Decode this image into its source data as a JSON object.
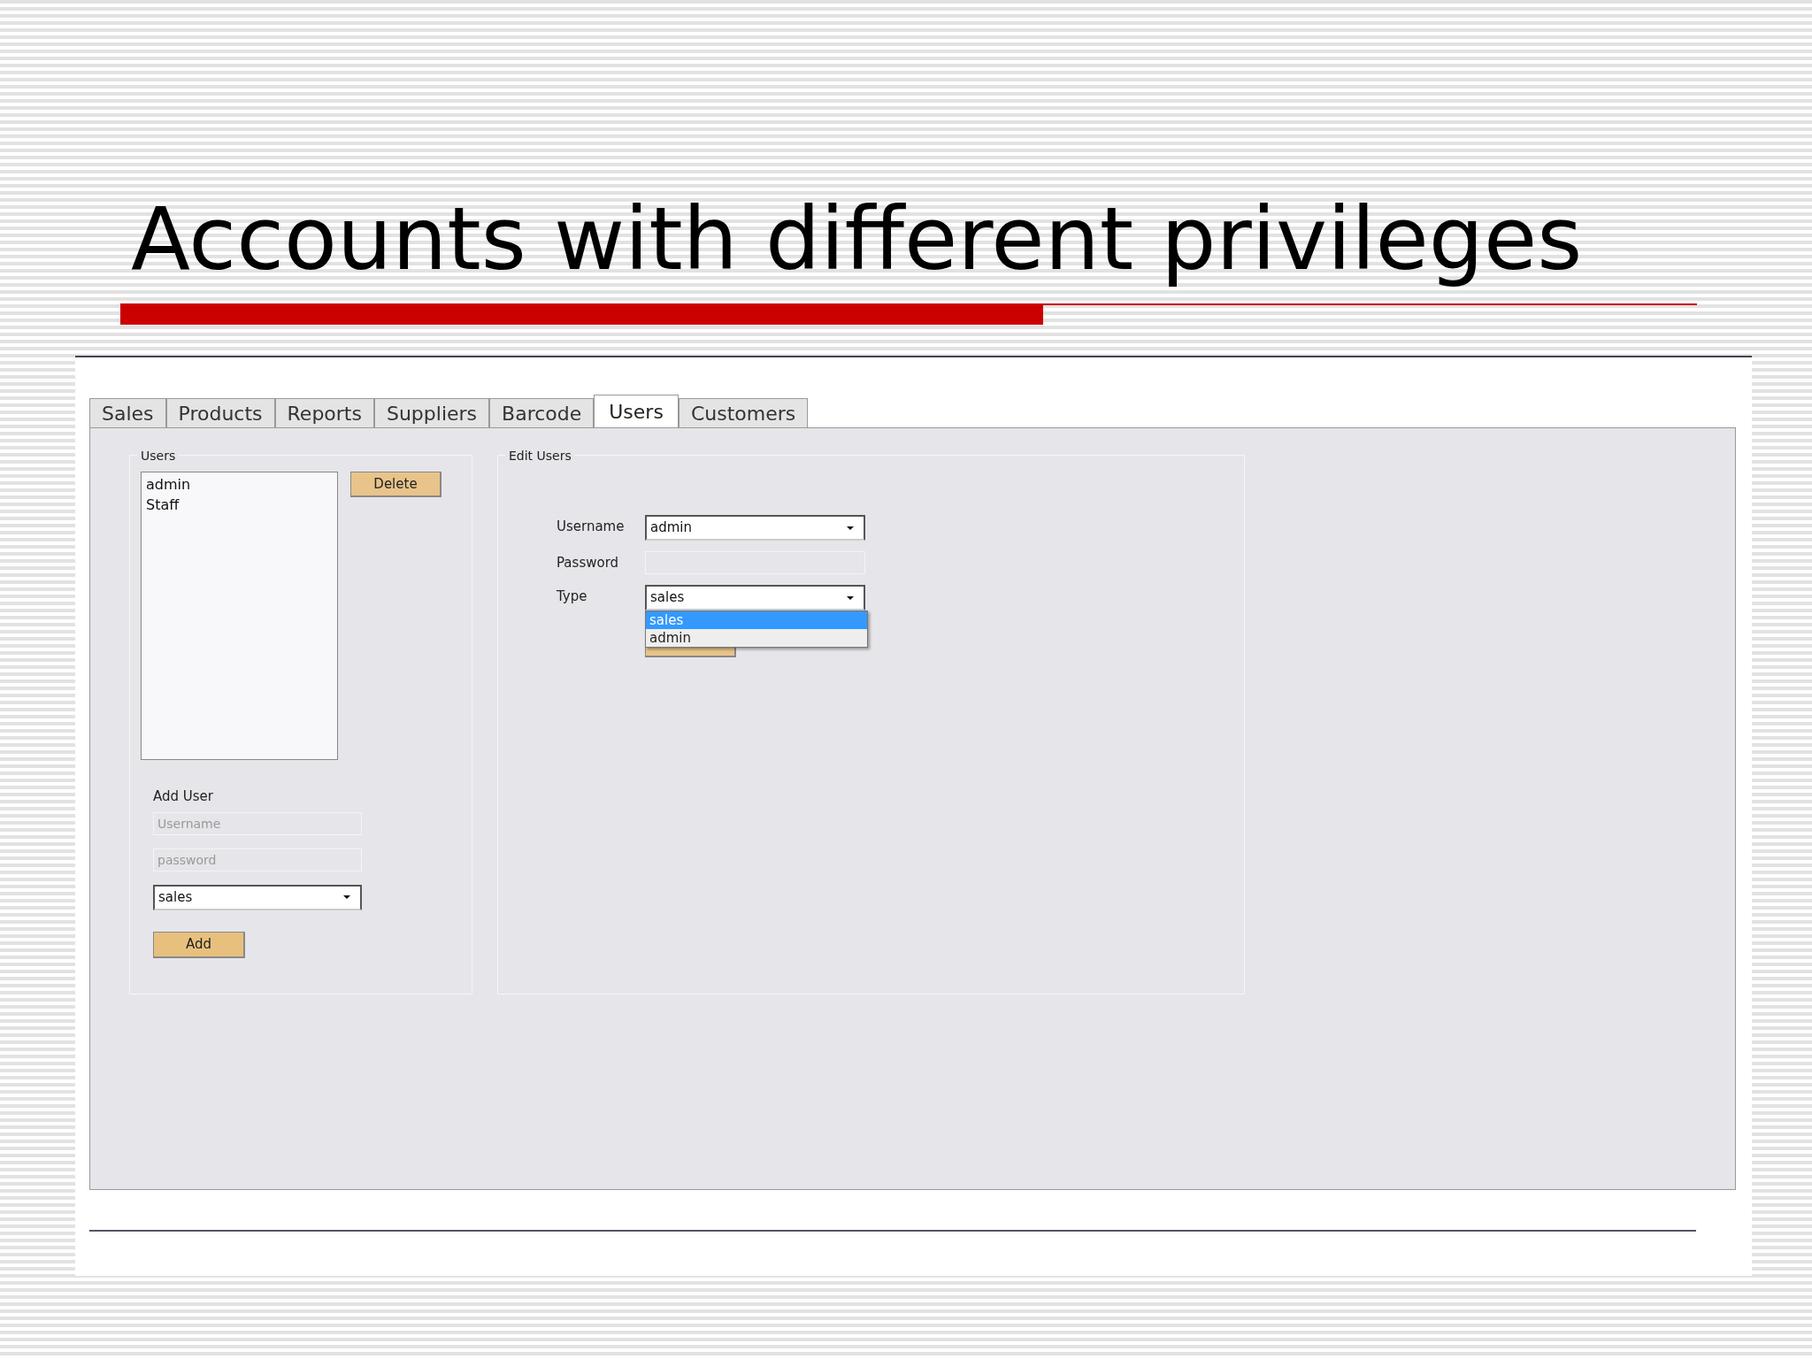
{
  "slide": {
    "title": "Accounts with different privileges"
  },
  "tabs": [
    {
      "label": "Sales",
      "selected": false
    },
    {
      "label": "Products",
      "selected": false
    },
    {
      "label": "Reports",
      "selected": false
    },
    {
      "label": "Suppliers",
      "selected": false
    },
    {
      "label": "Barcode",
      "selected": false
    },
    {
      "label": "Users",
      "selected": true
    },
    {
      "label": "Customers",
      "selected": false
    }
  ],
  "users_group": {
    "title": "Users",
    "list": [
      {
        "label": "admin"
      },
      {
        "label": "Staff"
      }
    ],
    "delete_button": "Delete",
    "add_user": {
      "title": "Add User",
      "username": {
        "placeholder": "Username"
      },
      "password": {
        "placeholder": "password"
      },
      "type": {
        "value": "sales"
      },
      "add_button": "Add"
    }
  },
  "edit_group": {
    "title": "Edit Users",
    "fields": [
      {
        "kind": "select",
        "label": "Username",
        "value": "admin",
        "expanded": false
      },
      {
        "kind": "text",
        "label": "Password"
      },
      {
        "kind": "select",
        "label": "Type",
        "value": "sales",
        "expanded": true,
        "options": [
          {
            "label": "sales",
            "selected": true
          },
          {
            "label": "admin",
            "selected": false
          }
        ]
      }
    ]
  }
}
